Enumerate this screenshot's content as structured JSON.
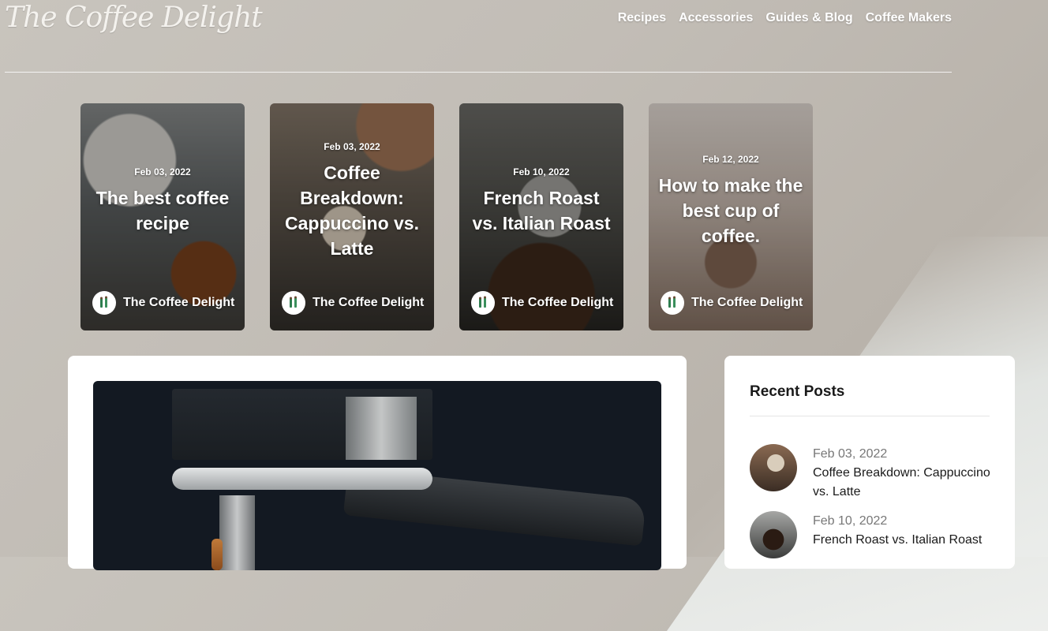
{
  "header": {
    "logo_text": "The Coffee Delight",
    "nav": [
      "Recipes",
      "Accessories",
      "Guides & Blog",
      "Coffee Makers"
    ]
  },
  "featured": [
    {
      "date": "Feb 03, 2022",
      "title": "The best coffee recipe",
      "author": "The Coffee Delight"
    },
    {
      "date": "Feb 03, 2022",
      "title": "Coffee Breakdown: Cappuccino vs. Latte",
      "author": "The Coffee Delight"
    },
    {
      "date": "Feb 10, 2022",
      "title": "French Roast vs. Italian Roast",
      "author": "The Coffee Delight"
    },
    {
      "date": "Feb 12, 2022",
      "title": "How to make the best cup of coffee.",
      "author": "The Coffee Delight"
    }
  ],
  "sidebar": {
    "title": "Recent Posts",
    "posts": [
      {
        "date": "Feb 03, 2022",
        "title": "Coffee Breakdown: Cappuccino vs. Latte"
      },
      {
        "date": "Feb 10, 2022",
        "title": "French Roast vs. Italian Roast"
      }
    ]
  }
}
